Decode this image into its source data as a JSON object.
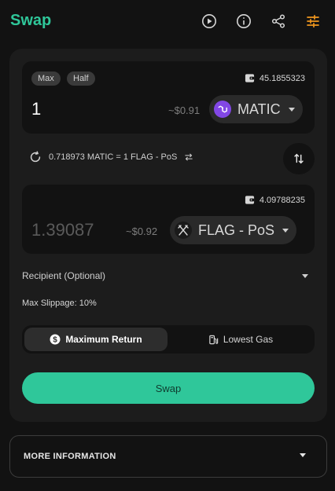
{
  "header": {
    "title": "Swap",
    "icons": [
      "play-circle-icon",
      "info-icon",
      "share-icon",
      "sliders-icon"
    ],
    "accent_color": "#2fc79a",
    "settings_color": "#f0961e"
  },
  "from": {
    "max_label": "Max",
    "half_label": "Half",
    "balance": "45.1855323",
    "amount": "1",
    "usd": "~$0.91",
    "token": "MATIC",
    "token_color": "#8247e5"
  },
  "rate": {
    "text": "0.718973 MATIC = 1 FLAG - PoS"
  },
  "to": {
    "balance": "4.09788235",
    "amount": "1.39087",
    "usd": "~$0.92",
    "token": "FLAG - PoS"
  },
  "recipient": {
    "label": "Recipient (Optional)"
  },
  "slippage": {
    "label": "Max Slippage: 10%"
  },
  "route": {
    "options": [
      "Maximum Return",
      "Lowest Gas"
    ],
    "selected": "Maximum Return"
  },
  "swap_button": {
    "label": "Swap"
  },
  "more_info": {
    "label": "MORE INFORMATION"
  }
}
